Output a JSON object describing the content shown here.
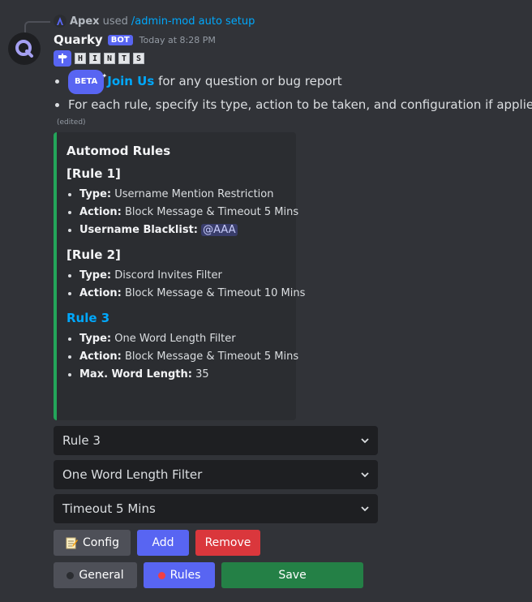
{
  "reply": {
    "username": "Apex",
    "used_text": "used",
    "command": "/admin-mod auto setup"
  },
  "message": {
    "author": "Quarky",
    "badge": "BOT",
    "timestamp": "Today at 8:28 PM",
    "hints_letters": [
      "H",
      "I",
      "N",
      "T",
      "S"
    ],
    "bullets": {
      "beta_label": "BETA",
      "join_link": "Join Us",
      "join_rest": "for any question or bug report",
      "rule_info": "For each rule, specify its type, action to be taken, and configuration if applied."
    },
    "edited": "(edited)"
  },
  "embed": {
    "accent_color": "#23a55a",
    "title": "Automod Rules",
    "rules": [
      {
        "heading": "[Rule 1]",
        "lines": [
          {
            "key": "Type:",
            "value": " Username Mention Restriction"
          },
          {
            "key": "Action:",
            "value": " Block Message  & Timeout 5 Mins"
          },
          {
            "key": "Username Blacklist:",
            "value": "@AAA"
          }
        ]
      },
      {
        "heading": "[Rule 2]",
        "lines": [
          {
            "key": "Type:",
            "value": " Discord Invites Filter"
          },
          {
            "key": "Action:",
            "value": " Block Message  & Timeout 10 Mins"
          }
        ]
      },
      {
        "heading": "Rule 3",
        "lines": [
          {
            "key": "Type:",
            "value": " One Word Length Filter"
          },
          {
            "key": "Action:",
            "value": " Block Message  & Timeout 5 Mins"
          },
          {
            "key": "Max. Word Length:",
            "value": " 35"
          }
        ]
      }
    ]
  },
  "selects": [
    "Rule 3",
    "One Word Length Filter",
    "Timeout 5 Mins"
  ],
  "buttons_row1": {
    "config": "Config",
    "add": "Add",
    "remove": "Remove"
  },
  "buttons_row2": {
    "general": "General",
    "rules": "Rules",
    "save": "Save"
  },
  "colors": {
    "blurple": "#5865f2",
    "red": "#da373c",
    "green": "#248046",
    "gray": "#4e5058",
    "link": "#00a8fc"
  }
}
